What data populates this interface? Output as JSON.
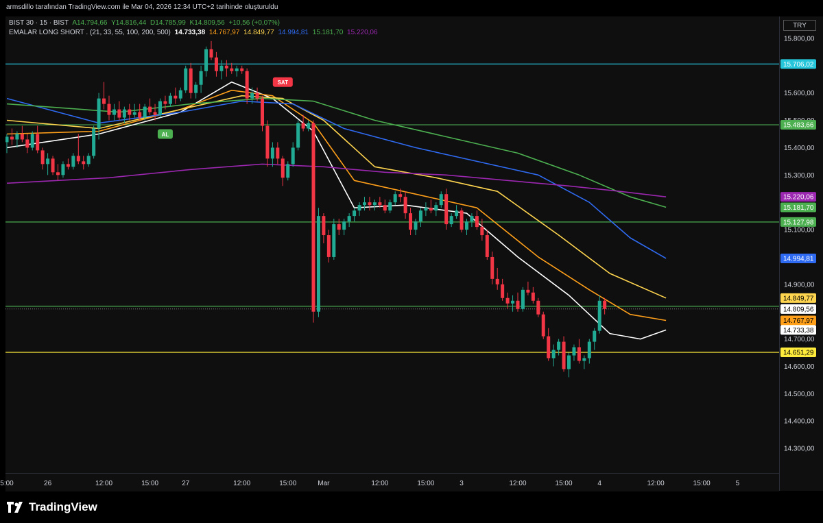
{
  "header": "armsdillo tarafından TradingView.com ile Mar 04, 2026 12:34 UTC+2 tarihinde oluşturuldu",
  "legend": {
    "symbol": "BIST 30 · 15 · BIST",
    "open": "A14.794,66",
    "high": "Y14.816,44",
    "low": "D14.785,99",
    "close": "K14.809,56",
    "change": "+10,56 (+0,07%)",
    "indicator": "EMALAR LONG SHORT . (21, 33, 55, 100, 200, 500)",
    "ema_values": [
      "14.733,38",
      "14.767,97",
      "14.849,77",
      "14.994,81",
      "15.181,70",
      "15.220,06"
    ]
  },
  "currency": "TRY",
  "brand": "TradingView",
  "colors": {
    "up": "#22ab94",
    "down": "#f23645",
    "ema21": "#ffffff",
    "ema33": "#ff9f1a",
    "ema55": "#ffd54f",
    "ema100": "#2f6bf2",
    "ema200": "#4caf50",
    "ema500": "#9c27b0",
    "cyan_line": "#26c6da",
    "green_line": "#4caf50",
    "yellow_line": "#ffeb3b"
  },
  "chart_data": {
    "type": "candlestick",
    "y_range": [
      14210,
      15880
    ],
    "y_ticks": [
      {
        "v": 15800,
        "label": "15.800,00"
      },
      {
        "v": 15600,
        "label": "15.600,00"
      },
      {
        "v": 15500,
        "label": "15.500,00"
      },
      {
        "v": 15400,
        "label": "15.400,00"
      },
      {
        "v": 15300,
        "label": "15.300,00"
      },
      {
        "v": 15100,
        "label": "15.100,00"
      },
      {
        "v": 14900,
        "label": "14.900,00"
      },
      {
        "v": 14700,
        "label": "14.700,00"
      },
      {
        "v": 14600,
        "label": "14.600,00"
      },
      {
        "v": 14500,
        "label": "14.500,00"
      },
      {
        "v": 14400,
        "label": "14.400,00"
      },
      {
        "v": 14300,
        "label": "14.300,00"
      }
    ],
    "x_ticks": [
      {
        "i": 0,
        "label": "5:00"
      },
      {
        "i": 8,
        "label": "26"
      },
      {
        "i": 19,
        "label": "12:00"
      },
      {
        "i": 28,
        "label": "15:00"
      },
      {
        "i": 35,
        "label": "27"
      },
      {
        "i": 46,
        "label": "12:00"
      },
      {
        "i": 55,
        "label": "15:00"
      },
      {
        "i": 62,
        "label": "Mar"
      },
      {
        "i": 73,
        "label": "12:00"
      },
      {
        "i": 82,
        "label": "15:00"
      },
      {
        "i": 89,
        "label": "3"
      },
      {
        "i": 100,
        "label": "12:00"
      },
      {
        "i": 109,
        "label": "15:00"
      },
      {
        "i": 116,
        "label": "4"
      },
      {
        "i": 127,
        "label": "12:00"
      },
      {
        "i": 136,
        "label": "15:00"
      },
      {
        "i": 143,
        "label": "5"
      }
    ],
    "bar_count": 145,
    "horizontal_levels": [
      {
        "name": "cyan",
        "value": 15706.02,
        "label": "15.706,02",
        "color": "#26c6da"
      },
      {
        "name": "green-1",
        "value": 15483.66,
        "label": "15.483,66",
        "color": "#4caf50"
      },
      {
        "name": "green-2",
        "value": 15127.98,
        "label": "15.127,98",
        "color": "#4caf50"
      },
      {
        "name": "green-3",
        "value": 14820,
        "label": "",
        "color": "#4caf50"
      },
      {
        "name": "yellow",
        "value": 14651.29,
        "label": "14.651,29",
        "color": "#ffeb3b"
      }
    ],
    "price_tags": [
      {
        "value": 15220.06,
        "label": "15.220,06",
        "bg": "#9c27b0",
        "fg": "#ffffff"
      },
      {
        "value": 15181.7,
        "label": "15.181,70",
        "bg": "#4caf50",
        "fg": "#ffffff"
      },
      {
        "value": 14994.81,
        "label": "14.994,81",
        "bg": "#2f6bf2",
        "fg": "#ffffff"
      },
      {
        "value": 14849.77,
        "label": "14.849,77",
        "bg": "#ffd54f",
        "fg": "#000000"
      },
      {
        "value": 14809.56,
        "label": "14.809,56",
        "bg": "#ffffff",
        "fg": "#000000"
      },
      {
        "value": 14767.97,
        "label": "14.767,97",
        "bg": "#ff9f1a",
        "fg": "#000000"
      },
      {
        "value": 14733.38,
        "label": "14.733,38",
        "bg": "#ffffff",
        "fg": "#000000"
      }
    ],
    "signals": [
      {
        "label": "AL",
        "i": 31,
        "value": 15450,
        "color": "#4caf50"
      },
      {
        "label": "SAT",
        "i": 54,
        "value": 15640,
        "color": "#f23645"
      }
    ],
    "candles": [
      [
        15420,
        15450,
        15380,
        15440
      ],
      [
        15440,
        15470,
        15410,
        15430
      ],
      [
        15430,
        15460,
        15400,
        15450
      ],
      [
        15450,
        15480,
        15420,
        15430
      ],
      [
        15430,
        15450,
        15380,
        15400
      ],
      [
        15400,
        15460,
        15390,
        15450
      ],
      [
        15450,
        15480,
        15380,
        15390
      ],
      [
        15390,
        15400,
        15320,
        15340
      ],
      [
        15340,
        15380,
        15300,
        15360
      ],
      [
        15360,
        15370,
        15300,
        15310
      ],
      [
        15310,
        15340,
        15280,
        15300
      ],
      [
        15300,
        15350,
        15290,
        15340
      ],
      [
        15340,
        15360,
        15320,
        15330
      ],
      [
        15330,
        15380,
        15320,
        15370
      ],
      [
        15370,
        15450,
        15340,
        15350
      ],
      [
        15350,
        15370,
        15320,
        15340
      ],
      [
        15340,
        15380,
        15330,
        15370
      ],
      [
        15370,
        15480,
        15360,
        15470
      ],
      [
        15470,
        15600,
        15430,
        15580
      ],
      [
        15580,
        15640,
        15540,
        15560
      ],
      [
        15560,
        15590,
        15500,
        15520
      ],
      [
        15520,
        15560,
        15500,
        15540
      ],
      [
        15540,
        15570,
        15500,
        15510
      ],
      [
        15510,
        15550,
        15490,
        15540
      ],
      [
        15540,
        15560,
        15500,
        15520
      ],
      [
        15520,
        15560,
        15510,
        15530
      ],
      [
        15530,
        15560,
        15500,
        15510
      ],
      [
        15510,
        15560,
        15500,
        15550
      ],
      [
        15550,
        15580,
        15520,
        15530
      ],
      [
        15530,
        15560,
        15500,
        15520
      ],
      [
        15520,
        15580,
        15510,
        15570
      ],
      [
        15570,
        15590,
        15540,
        15560
      ],
      [
        15560,
        15600,
        15550,
        15590
      ],
      [
        15590,
        15620,
        15560,
        15580
      ],
      [
        15580,
        15620,
        15570,
        15610
      ],
      [
        15610,
        15700,
        15600,
        15690
      ],
      [
        15690,
        15710,
        15580,
        15600
      ],
      [
        15600,
        15640,
        15580,
        15630
      ],
      [
        15630,
        15700,
        15600,
        15680
      ],
      [
        15680,
        15770,
        15660,
        15760
      ],
      [
        15760,
        15790,
        15720,
        15730
      ],
      [
        15730,
        15750,
        15660,
        15680
      ],
      [
        15680,
        15720,
        15650,
        15700
      ],
      [
        15700,
        15720,
        15660,
        15690
      ],
      [
        15690,
        15710,
        15670,
        15680
      ],
      [
        15680,
        15700,
        15660,
        15690
      ],
      [
        15690,
        15700,
        15670,
        15680
      ],
      [
        15680,
        15690,
        15560,
        15580
      ],
      [
        15580,
        15620,
        15560,
        15600
      ],
      [
        15600,
        15620,
        15570,
        15580
      ],
      [
        15580,
        15590,
        15460,
        15480
      ],
      [
        15480,
        15500,
        15330,
        15360
      ],
      [
        15360,
        15420,
        15330,
        15400
      ],
      [
        15400,
        15420,
        15340,
        15360
      ],
      [
        15360,
        15370,
        15260,
        15290
      ],
      [
        15290,
        15350,
        15280,
        15340
      ],
      [
        15340,
        15420,
        15330,
        15400
      ],
      [
        15400,
        15500,
        15390,
        15490
      ],
      [
        15490,
        15520,
        15460,
        15470
      ],
      [
        15470,
        15500,
        15460,
        15490
      ],
      [
        15490,
        15500,
        14760,
        14800
      ],
      [
        14800,
        15180,
        14780,
        15150
      ],
      [
        15150,
        15160,
        15050,
        15080
      ],
      [
        15080,
        15100,
        14980,
        15000
      ],
      [
        15000,
        15140,
        14990,
        15120
      ],
      [
        15120,
        15140,
        15080,
        15100
      ],
      [
        15100,
        15140,
        15080,
        15130
      ],
      [
        15130,
        15160,
        15110,
        15150
      ],
      [
        15150,
        15180,
        15130,
        15170
      ],
      [
        15170,
        15200,
        15150,
        15190
      ],
      [
        15190,
        15220,
        15170,
        15200
      ],
      [
        15200,
        15220,
        15170,
        15190
      ],
      [
        15190,
        15210,
        15170,
        15200
      ],
      [
        15200,
        15220,
        15180,
        15190
      ],
      [
        15190,
        15210,
        15160,
        15170
      ],
      [
        15170,
        15210,
        15160,
        15200
      ],
      [
        15200,
        15240,
        15190,
        15230
      ],
      [
        15230,
        15250,
        15200,
        15220
      ],
      [
        15220,
        15240,
        15140,
        15160
      ],
      [
        15160,
        15180,
        15080,
        15100
      ],
      [
        15100,
        15140,
        15080,
        15130
      ],
      [
        15130,
        15180,
        15110,
        15170
      ],
      [
        15170,
        15200,
        15150,
        15180
      ],
      [
        15180,
        15210,
        15160,
        15170
      ],
      [
        15170,
        15200,
        15150,
        15190
      ],
      [
        15190,
        15240,
        15180,
        15230
      ],
      [
        15230,
        15250,
        15100,
        15120
      ],
      [
        15120,
        15160,
        15110,
        15150
      ],
      [
        15150,
        15190,
        15140,
        15170
      ],
      [
        15170,
        15180,
        15090,
        15100
      ],
      [
        15100,
        15140,
        15080,
        15130
      ],
      [
        15130,
        15160,
        15110,
        15150
      ],
      [
        15150,
        15170,
        15100,
        15110
      ],
      [
        15110,
        15140,
        15060,
        15080
      ],
      [
        15080,
        15100,
        14990,
        15000
      ],
      [
        15000,
        15020,
        14900,
        14920
      ],
      [
        14920,
        14960,
        14880,
        14900
      ],
      [
        14900,
        14920,
        14840,
        14850
      ],
      [
        14850,
        14870,
        14810,
        14830
      ],
      [
        14830,
        14860,
        14800,
        14840
      ],
      [
        14840,
        14870,
        14800,
        14810
      ],
      [
        14810,
        14890,
        14800,
        14880
      ],
      [
        14880,
        14910,
        14860,
        14870
      ],
      [
        14870,
        14890,
        14830,
        14840
      ],
      [
        14840,
        14850,
        14780,
        14790
      ],
      [
        14790,
        14800,
        14700,
        14710
      ],
      [
        14710,
        14740,
        14620,
        14630
      ],
      [
        14630,
        14680,
        14600,
        14660
      ],
      [
        14660,
        14700,
        14640,
        14690
      ],
      [
        14690,
        14710,
        14580,
        14590
      ],
      [
        14590,
        14650,
        14560,
        14640
      ],
      [
        14640,
        14680,
        14620,
        14670
      ],
      [
        14670,
        14700,
        14610,
        14620
      ],
      [
        14620,
        14640,
        14590,
        14630
      ],
      [
        14630,
        14700,
        14610,
        14690
      ],
      [
        14690,
        14740,
        14660,
        14730
      ],
      [
        14730,
        14860,
        14720,
        14840
      ],
      [
        14840,
        14850,
        14790,
        14810
      ]
    ],
    "emas": {
      "ema21": {
        "color": "#ffffff",
        "points": [
          [
            0,
            15400
          ],
          [
            18,
            15450
          ],
          [
            34,
            15530
          ],
          [
            44,
            15640
          ],
          [
            52,
            15580
          ],
          [
            60,
            15460
          ],
          [
            68,
            15180
          ],
          [
            78,
            15190
          ],
          [
            90,
            15160
          ],
          [
            100,
            15000
          ],
          [
            110,
            14860
          ],
          [
            118,
            14720
          ],
          [
            124,
            14700
          ],
          [
            129,
            14733
          ]
        ]
      },
      "ema33": {
        "color": "#ff9f1a",
        "points": [
          [
            0,
            15450
          ],
          [
            18,
            15460
          ],
          [
            34,
            15540
          ],
          [
            44,
            15610
          ],
          [
            52,
            15590
          ],
          [
            60,
            15490
          ],
          [
            68,
            15280
          ],
          [
            80,
            15230
          ],
          [
            92,
            15180
          ],
          [
            104,
            15000
          ],
          [
            114,
            14880
          ],
          [
            122,
            14790
          ],
          [
            129,
            14768
          ]
        ]
      },
      "ema55": {
        "color": "#ffd54f",
        "points": [
          [
            0,
            15500
          ],
          [
            18,
            15470
          ],
          [
            34,
            15540
          ],
          [
            46,
            15590
          ],
          [
            54,
            15580
          ],
          [
            62,
            15500
          ],
          [
            72,
            15330
          ],
          [
            84,
            15290
          ],
          [
            96,
            15240
          ],
          [
            108,
            15080
          ],
          [
            118,
            14940
          ],
          [
            129,
            14850
          ]
        ]
      },
      "ema100": {
        "color": "#2f6bf2",
        "points": [
          [
            0,
            15580
          ],
          [
            18,
            15490
          ],
          [
            34,
            15530
          ],
          [
            46,
            15570
          ],
          [
            56,
            15560
          ],
          [
            66,
            15470
          ],
          [
            80,
            15400
          ],
          [
            92,
            15350
          ],
          [
            104,
            15300
          ],
          [
            114,
            15200
          ],
          [
            122,
            15070
          ],
          [
            129,
            14995
          ]
        ]
      },
      "ema200": {
        "color": "#4caf50",
        "points": [
          [
            0,
            15560
          ],
          [
            22,
            15530
          ],
          [
            36,
            15560
          ],
          [
            50,
            15580
          ],
          [
            60,
            15570
          ],
          [
            72,
            15500
          ],
          [
            86,
            15440
          ],
          [
            100,
            15380
          ],
          [
            112,
            15300
          ],
          [
            122,
            15220
          ],
          [
            129,
            15182
          ]
        ]
      },
      "ema500": {
        "color": "#9c27b0",
        "points": [
          [
            0,
            15270
          ],
          [
            20,
            15290
          ],
          [
            36,
            15320
          ],
          [
            50,
            15340
          ],
          [
            62,
            15330
          ],
          [
            74,
            15310
          ],
          [
            86,
            15300
          ],
          [
            98,
            15280
          ],
          [
            110,
            15260
          ],
          [
            120,
            15240
          ],
          [
            129,
            15220
          ]
        ]
      }
    }
  }
}
